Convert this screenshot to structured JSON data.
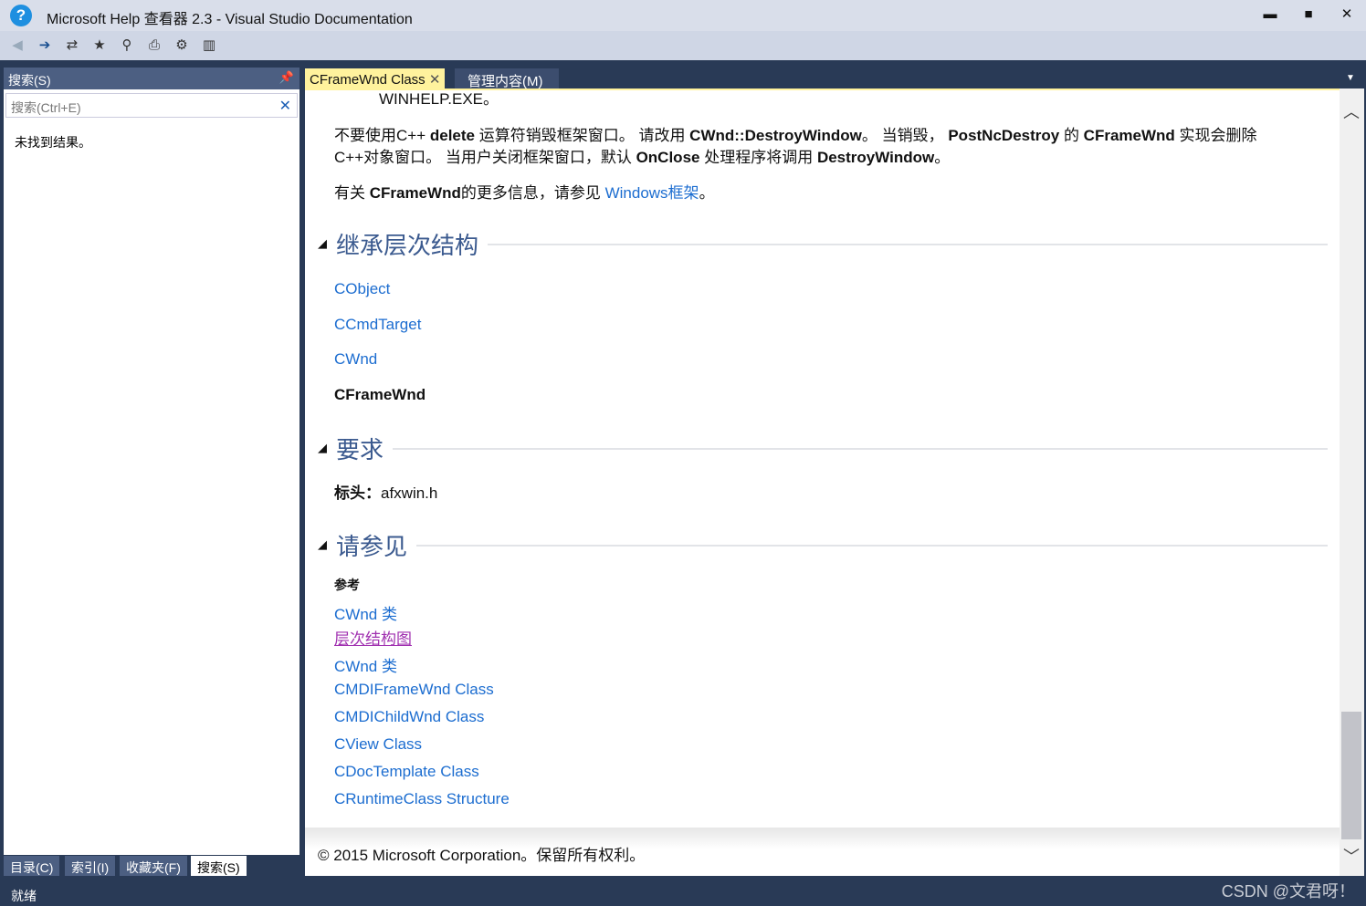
{
  "window": {
    "title": "Microsoft Help 查看器 2.3 - Visual Studio Documentation",
    "minimize": "▬",
    "maximize": "■",
    "close": "✕"
  },
  "toolbar": {
    "icons": [
      "back-icon",
      "forward-icon",
      "sync-icon",
      "add-favorite-icon",
      "find-icon",
      "print-icon",
      "settings-icon",
      "library-icon"
    ]
  },
  "left_panel": {
    "title": "搜索(S)",
    "search_placeholder": "搜索(Ctrl+E)",
    "no_results": "未找到结果。",
    "tabs": [
      "目录(C)",
      "索引(I)",
      "收藏夹(F)",
      "搜索(S)"
    ]
  },
  "tabs": [
    {
      "label": "CFrameWnd Class",
      "active": true
    },
    {
      "label": "管理内容(M)",
      "active": false
    }
  ],
  "content": {
    "top_line": "WINHELP.EXE。",
    "para1_line1": [
      "不要使用C++ ",
      "delete",
      " 运算符销毁框架窗口。 请改用 ",
      "CWnd::DestroyWindow",
      "。 当销毁， ",
      "PostNcDestroy",
      " 的 ",
      "CFrameWnd",
      " 实现会删除"
    ],
    "para1_line2": [
      "C++对象窗口。 当用户关闭框架窗口，默认 ",
      "OnClose",
      " 处理程序将调用 ",
      "DestroyWindow",
      "。"
    ],
    "para2": [
      "有关 ",
      "CFrameWnd",
      "的更多信息，请参见 ",
      "Windows框架",
      "。"
    ],
    "inheritance_heading": "继承层次结构",
    "inheritance": [
      "CObject",
      "CCmdTarget",
      "CWnd",
      "CFrameWnd"
    ],
    "requirements_heading": "要求",
    "header_label": "标头：",
    "header_value": "afxwin.h",
    "see_also_heading": "请参见",
    "reference_label": "参考",
    "see_also": [
      "CWnd 类",
      "层次结构图",
      "CWnd 类",
      "CMDIFrameWnd Class",
      "CMDIChildWnd Class",
      "CView Class",
      "CDocTemplate Class",
      "CRuntimeClass Structure"
    ],
    "footer": "© 2015 Microsoft Corporation。保留所有权利。"
  },
  "status": "就绪",
  "watermark": "CSDN @文君呀！",
  "colors": {
    "tab_active": "#fff29d",
    "link": "#1c6dd0",
    "visited_link": "#a030b0",
    "heading": "#3b5a8f",
    "frame": "#293a56"
  }
}
